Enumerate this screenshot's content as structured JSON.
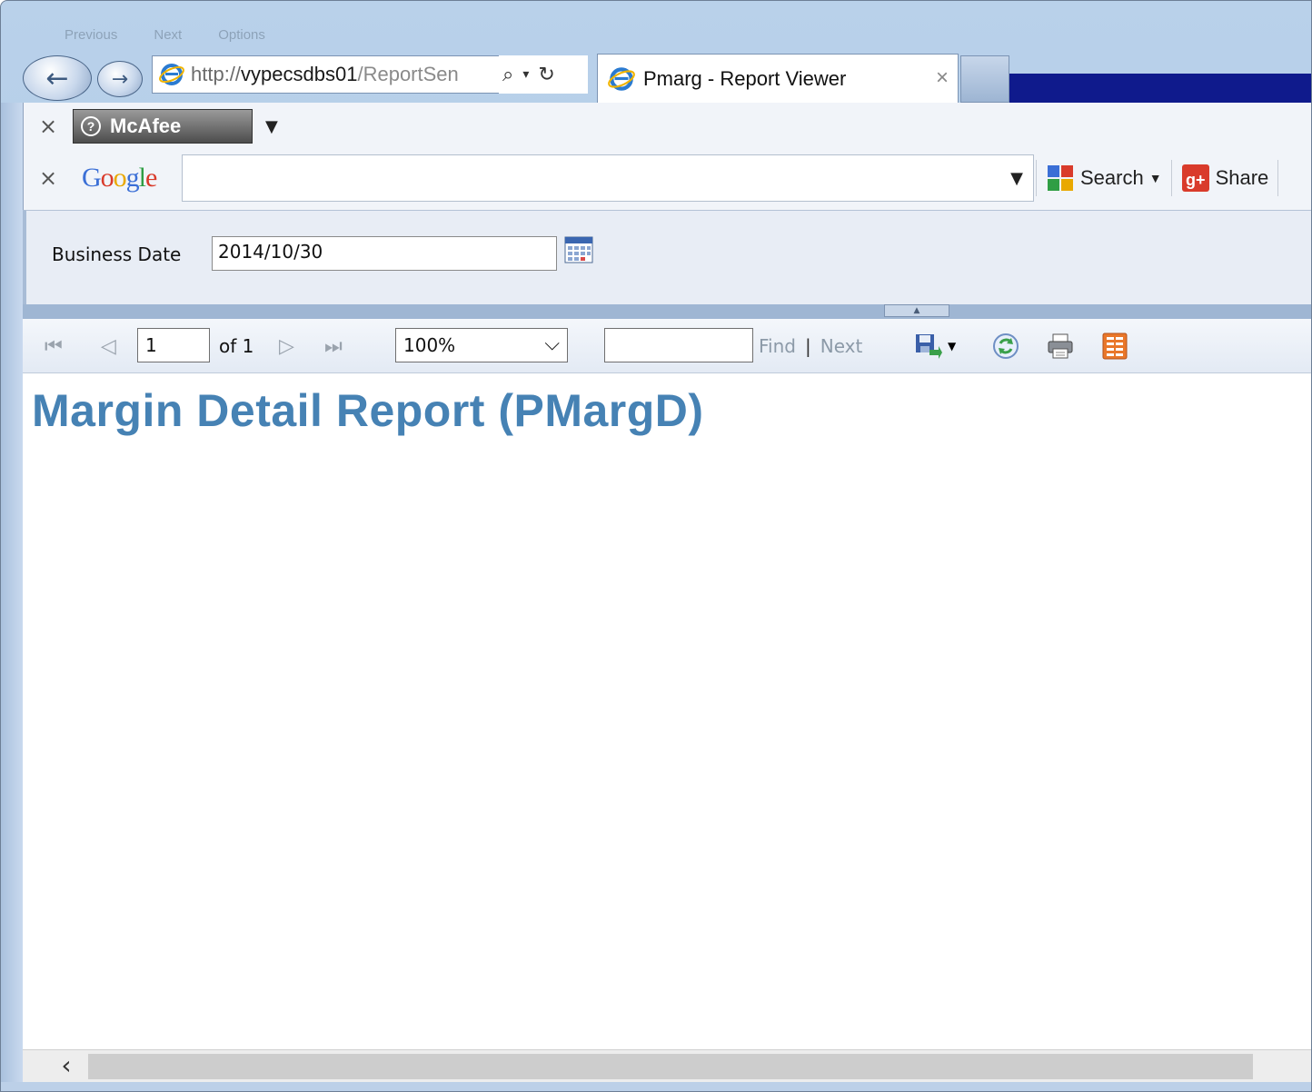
{
  "browser": {
    "ghost_menu": [
      "Previous",
      "Next",
      "Options"
    ],
    "address_prefix": "http://",
    "address_host": "vypecsdbs01",
    "address_tail": "/ReportSen",
    "tab_title": "Pmarg - Report Viewer",
    "tab_close": "×",
    "colors": {
      "title_strip": "#0f1a8c",
      "frame": "#b9d1ea"
    }
  },
  "toolbars": {
    "close": "×",
    "mcafee_label": "McAfee",
    "google_logo": "Google",
    "google_query": "",
    "search_label": "Search",
    "share_label": "Share"
  },
  "params": {
    "label": "Business Date",
    "value": "2014/10/30"
  },
  "report_toolbar": {
    "page_value": "1",
    "of_label": "of 1",
    "zoom_value": "100%",
    "find_value": "",
    "find_label": "Find",
    "separator": "|",
    "next_label": "Next"
  },
  "report": {
    "title": "Margin Detail Report (PMargD)",
    "title_color": "#4682b4"
  }
}
